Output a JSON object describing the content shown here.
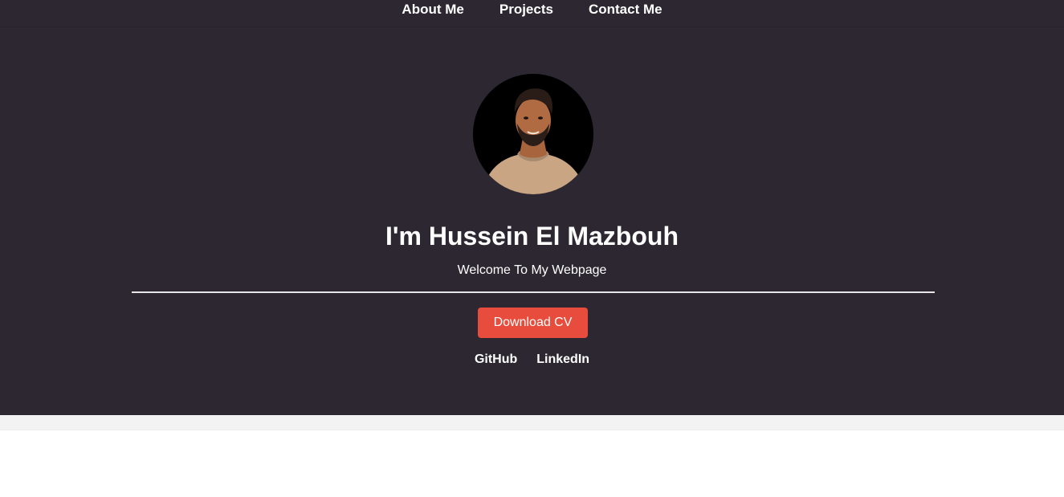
{
  "nav": {
    "items": [
      {
        "label": "About Me"
      },
      {
        "label": "Projects"
      },
      {
        "label": "Contact Me"
      }
    ]
  },
  "hero": {
    "title": "I'm Hussein El Mazbouh",
    "subtitle": "Welcome To My Webpage",
    "cv_button_label": "Download CV",
    "social": [
      {
        "label": "GitHub"
      },
      {
        "label": "LinkedIn"
      }
    ],
    "avatar_alt": "profile-photo"
  },
  "colors": {
    "hero_bg": "#2d2731",
    "button": "#e74c3c",
    "divider": "#e6e6e6",
    "band": "#f3f3f3"
  }
}
